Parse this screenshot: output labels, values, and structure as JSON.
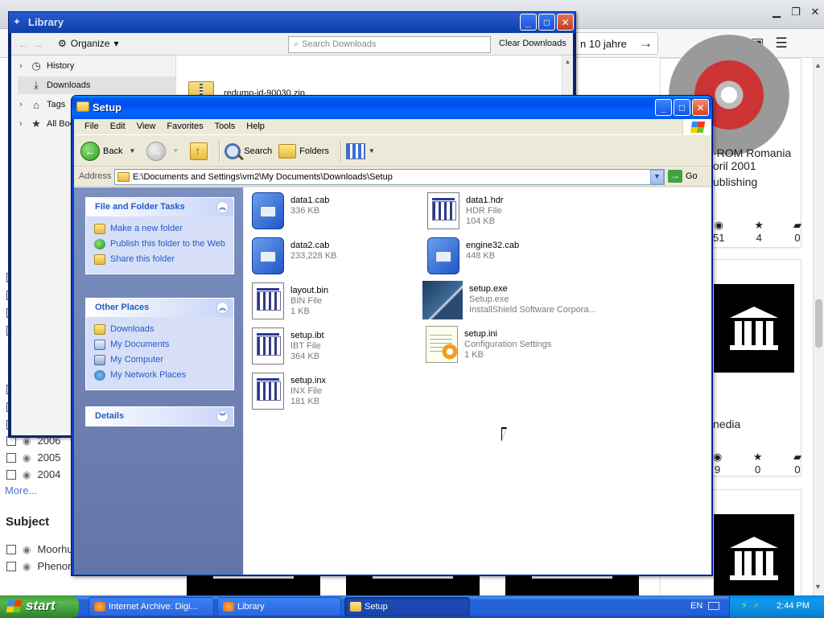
{
  "background_page": {
    "url_fragment": "n 10 jahre",
    "facets": [
      {
        "label": "2006"
      },
      {
        "label": "2005"
      },
      {
        "label": "2004"
      }
    ],
    "more_link": "More...",
    "subject_heading": "Subject",
    "subject_items": [
      {
        "label": "Moorhu"
      },
      {
        "label": "Phenon"
      }
    ],
    "results": [
      {
        "line1": "-ROM Romania",
        "line2": "oril 2001",
        "line3": "ublishing",
        "stats": [
          "51",
          "4",
          "0"
        ]
      },
      {
        "line1": "nedia",
        "stats": [
          "9",
          "0",
          "0"
        ]
      }
    ]
  },
  "library": {
    "title": "Library",
    "organize_label": "Organize",
    "search_placeholder": "Search Downloads",
    "clear_label": "Clear Downloads",
    "sidebar": [
      {
        "label": "History"
      },
      {
        "label": "Downloads"
      },
      {
        "label": "Tags"
      },
      {
        "label": "All Book"
      }
    ],
    "download_item": "redump-id-90030.zip"
  },
  "setup": {
    "title": "Setup",
    "menu": [
      "File",
      "Edit",
      "View",
      "Favorites",
      "Tools",
      "Help"
    ],
    "toolbar": {
      "back": "Back",
      "search": "Search",
      "folders": "Folders"
    },
    "address_label": "Address",
    "address_value": "E:\\Documents and Settings\\vm2\\My Documents\\Downloads\\Setup",
    "go_label": "Go",
    "tasks": {
      "file_folder_title": "File and Folder Tasks",
      "file_folder_items": [
        "Make a new folder",
        "Publish this folder to the Web",
        "Share this folder"
      ],
      "other_places_title": "Other Places",
      "other_places_items": [
        "Downloads",
        "My Documents",
        "My Computer",
        "My Network Places"
      ],
      "details_title": "Details"
    },
    "files": [
      {
        "name": "data1.cab",
        "type": "",
        "size": "336 KB",
        "icon": "cab-icon"
      },
      {
        "name": "data1.hdr",
        "type": "HDR File",
        "size": "104 KB",
        "icon": "document-icon"
      },
      {
        "name": "data2.cab",
        "type": "",
        "size": "233,228 KB",
        "icon": "cab-icon"
      },
      {
        "name": "engine32.cab",
        "type": "",
        "size": "448 KB",
        "icon": "cab-icon"
      },
      {
        "name": "layout.bin",
        "type": "BIN File",
        "size": "1 KB",
        "icon": "document-icon"
      },
      {
        "name": "setup.exe",
        "type": "Setup.exe",
        "size": "InstallShield Software Corpora...",
        "icon": "installshield-icon"
      },
      {
        "name": "setup.ibt",
        "type": "IBT File",
        "size": "364 KB",
        "icon": "document-icon"
      },
      {
        "name": "setup.ini",
        "type": "Configuration Settings",
        "size": "1 KB",
        "icon": "ini-icon"
      },
      {
        "name": "setup.inx",
        "type": "INX File",
        "size": "181 KB",
        "icon": "document-icon"
      }
    ]
  },
  "taskbar": {
    "start_label": "start",
    "buttons": [
      {
        "label": "Internet Archive: Digi..."
      },
      {
        "label": "Library"
      },
      {
        "label": "Setup"
      }
    ],
    "language": "EN",
    "clock": "2:44 PM"
  },
  "colors": {
    "xp_blue": "#0050ee",
    "taskpane_link": "#215dc6",
    "start_green": "#3c9a36"
  }
}
